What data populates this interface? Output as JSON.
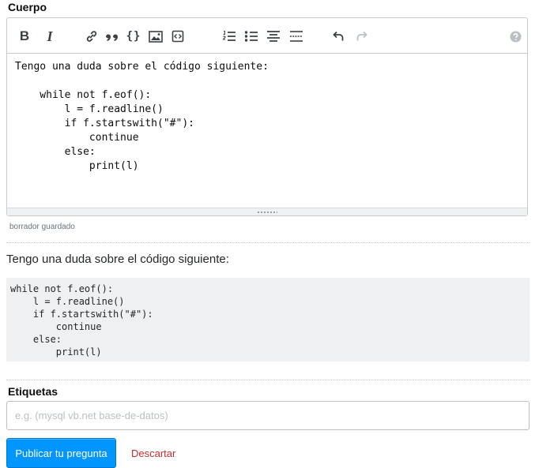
{
  "body_section": {
    "label": "Cuerpo",
    "toolbar": {
      "buttons": [
        {
          "icon": "bold-icon",
          "glyph": "B"
        },
        {
          "icon": "italic-icon",
          "glyph": "I"
        },
        {
          "icon": "link-icon"
        },
        {
          "icon": "blockquote-icon"
        },
        {
          "icon": "code-icon",
          "glyph": "{}"
        },
        {
          "icon": "image-icon"
        },
        {
          "icon": "snippet-icon"
        },
        {
          "icon": "ordered-list-icon"
        },
        {
          "icon": "bulleted-list-icon"
        },
        {
          "icon": "heading-icon"
        },
        {
          "icon": "horizontal-rule-icon"
        },
        {
          "icon": "undo-icon"
        },
        {
          "icon": "redo-icon",
          "state": "disabled"
        },
        {
          "icon": "help-icon"
        }
      ]
    },
    "editor_text": "Tengo una duda sobre el código siguiente:\n\n    while not f.eof():\n        l = f.readline()\n        if f.startswith(\"#\"):\n            continue\n        else:\n            print(l)",
    "draft_status": "borrador guardado"
  },
  "preview": {
    "paragraph": "Tengo una duda sobre el código siguiente:",
    "code": "while not f.eof():\n    l = f.readline()\n    if f.startswith(\"#\"):\n        continue\n    else:\n        print(l)"
  },
  "tags_section": {
    "label": "Etiquetas",
    "placeholder": "e.g. (mysql vb.net base-de-datos)",
    "value": ""
  },
  "actions": {
    "submit_label": "Publicar tu pregunta",
    "discard_label": "Descartar"
  },
  "colors": {
    "primary": "#0095ff",
    "discard": "#c22e32",
    "border": "#c8ccd0",
    "code_bg": "#eff0f1"
  }
}
